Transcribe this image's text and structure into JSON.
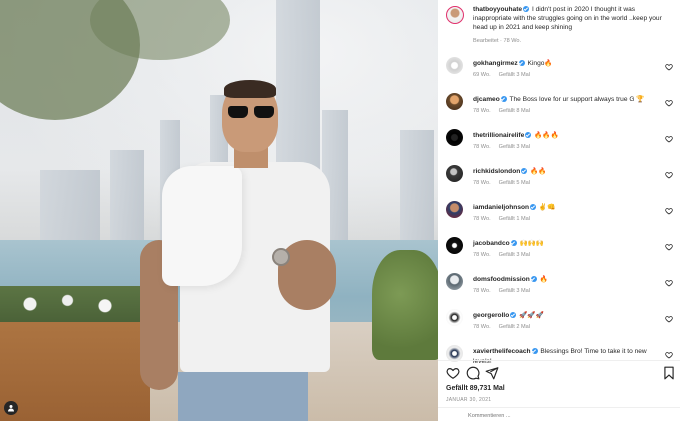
{
  "post": {
    "author": "thatboyyouhate",
    "caption": "I didn't post in 2020 I thought it was inappropriate with the struggles going on in the world ..keep your head up in 2021 and keep shining",
    "caption_meta": "Bearbeitet · 78 Wo.",
    "likes": "Gefällt 89,731 Mal",
    "date": "JANUAR 30, 2021",
    "add_comment_placeholder": "Kommentieren ..."
  },
  "comments": [
    {
      "user": "gokhangirmez",
      "text": "Kingo🔥",
      "age": "69 Wo.",
      "likes": "Gefällt 3 Mal"
    },
    {
      "user": "djcameo",
      "text": "The Boss love for ur support always true G 🏆",
      "age": "78 Wo.",
      "likes": "Gefällt 8 Mal"
    },
    {
      "user": "thetrillionairelife",
      "text": "🔥🔥🔥",
      "age": "78 Wo.",
      "likes": "Gefällt 3 Mal"
    },
    {
      "user": "richkidslondon",
      "text": "🔥🔥",
      "age": "78 Wo.",
      "likes": "Gefällt 5 Mal"
    },
    {
      "user": "iamdanieljohnson",
      "text": "✌️👊",
      "age": "78 Wo.",
      "likes": "Gefällt 1 Mal"
    },
    {
      "user": "jacobandco",
      "text": "🙌🙌🙌",
      "age": "78 Wo.",
      "likes": "Gefällt 3 Mal"
    },
    {
      "user": "domsfoodmission",
      "text": "🔥",
      "age": "78 Wo.",
      "likes": "Gefällt 3 Mal"
    },
    {
      "user": "georgerollo",
      "text": "🚀🚀🚀",
      "age": "78 Wo.",
      "likes": "Gefällt 2 Mal"
    },
    {
      "user": "xavierthelifecoach",
      "text": "Blessings Bro! Time to take it to new levels!",
      "age": "",
      "likes": ""
    }
  ],
  "icons": {
    "like": "heart-icon",
    "comment": "comment-icon",
    "share": "share-icon",
    "save": "bookmark-icon",
    "tag": "user-tag-icon"
  },
  "colors": {
    "verified": "#3897f0",
    "text": "#262626",
    "muted": "#8e8e8e",
    "story_ring": "#e1306c"
  }
}
